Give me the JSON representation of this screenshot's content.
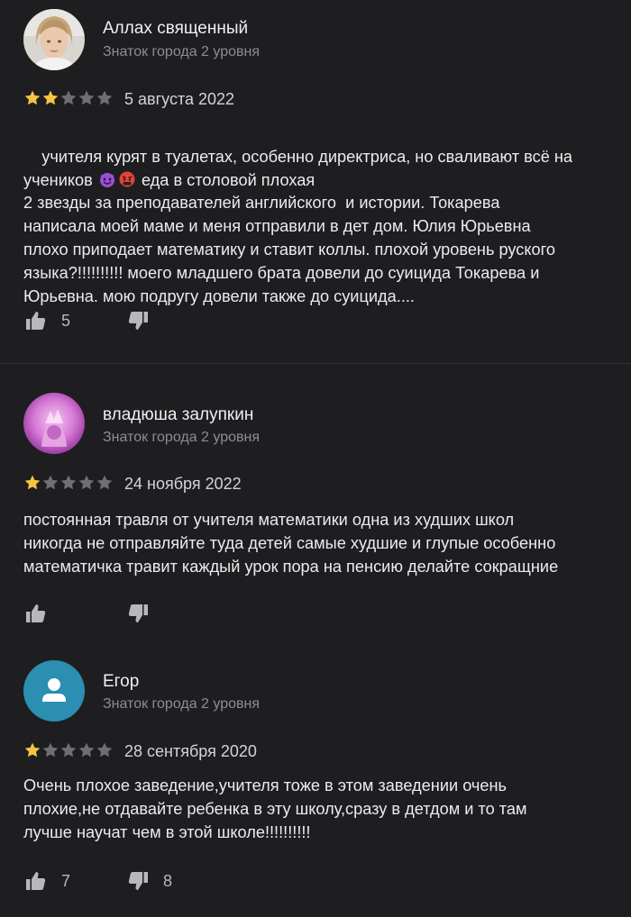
{
  "reviews": [
    {
      "author": "Аллах священный",
      "level": "Знаток города 2 уровня",
      "rating": 2,
      "date": "5 августа 2022",
      "text_line1_before": "учителя курят в туалетах, особенно директриса, но сваливают всё на",
      "text_line2_prefix": "учеников ",
      "emoji1": "smiling-imp-emoji",
      "emoji2": "angry-face-emoji",
      "text_line2_suffix": " еда в столовой плохая",
      "text_rest": "2 звезды за преподавателей английского  и истории. Токарева\nнаписала моей маме и меня отправили в дет дом. Юлия Юрьевна\nплохо приподает математику и ставит коллы. плохой уровень руского\nязыка?!!!!!!!!!! моего младшего брата довели до суицида Токарева и\nЮрьевна. мою подругу довели также до суицида....",
      "likes": "5",
      "dislikes": ""
    },
    {
      "author": "владюша залупкин",
      "level": "Знаток города 2 уровня",
      "rating": 1,
      "date": "24 ноября 2022",
      "text": "постоянная травля от учителя математики одна из худших школ\nникогда не отправляйте туда детей самые худшие и глупые особенно\nматематичка травит каждый урок пора на пенсию делайте сокращние",
      "likes": "",
      "dislikes": ""
    },
    {
      "author": "Егор",
      "level": "Знаток города 2 уровня",
      "rating": 1,
      "date": "28 сентября 2020",
      "text": "Очень плохое заведение,учителя тоже в этом заведении очень\nплохие,не отдавайте ребенка в эту школу,сразу в детдом и то там\nлучше научат чем в этой школе!!!!!!!!!!",
      "likes": "7",
      "dislikes": "8"
    }
  ],
  "colors": {
    "background": "#1e1e20",
    "star_filled": "#f6c343",
    "star_empty": "#6f6f73",
    "avatar_default": "#2a8fb0"
  },
  "icons": {
    "like": "thumbs-up-icon",
    "dislike": "thumbs-down-icon",
    "default_avatar": "user-silhouette-icon"
  }
}
